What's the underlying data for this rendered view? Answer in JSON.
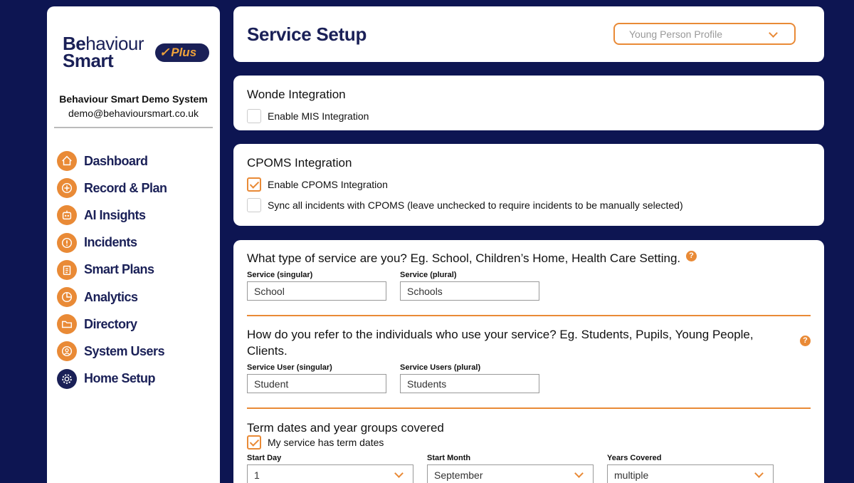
{
  "brand": {
    "logo_be": "Be",
    "logo_rest": "haviour",
    "logo_smart": "Smart",
    "plus_label": "Plus",
    "plus_check": "✓",
    "org_name": "Behaviour Smart Demo System",
    "org_email": "demo@behavioursmart.co.uk"
  },
  "nav": [
    {
      "label": "Dashboard",
      "icon": "home-icon"
    },
    {
      "label": "Record & Plan",
      "icon": "plus-circle-icon"
    },
    {
      "label": "AI Insights",
      "icon": "robot-icon"
    },
    {
      "label": "Incidents",
      "icon": "exclamation-icon"
    },
    {
      "label": "Smart Plans",
      "icon": "clipboard-icon"
    },
    {
      "label": "Analytics",
      "icon": "pie-chart-icon"
    },
    {
      "label": "Directory",
      "icon": "folder-icon"
    },
    {
      "label": "System Users",
      "icon": "user-icon"
    },
    {
      "label": "Home Setup",
      "icon": "gear-icon"
    }
  ],
  "header": {
    "title": "Service Setup",
    "profile_select": "Young Person Profile"
  },
  "wonde": {
    "title": "Wonde Integration",
    "enable_label": "Enable MIS Integration",
    "enable_checked": false
  },
  "cpoms": {
    "title": "CPOMS Integration",
    "enable_label": "Enable CPOMS Integration",
    "enable_checked": true,
    "sync_label": "Sync all incidents with CPOMS (leave unchecked to require incidents to be manually selected)",
    "sync_checked": false
  },
  "service": {
    "question": "What type of service are you? Eg. School, Children’s Home, Health Care Setting.",
    "help": "?",
    "singular_label": "Service (singular)",
    "singular_value": "School",
    "plural_label": "Service (plural)",
    "plural_value": "Schools"
  },
  "users": {
    "question": "How do you refer to the individuals who use your service? Eg. Students, Pupils, Young People, Clients.",
    "help": "?",
    "singular_label": "Service User (singular)",
    "singular_value": "Student",
    "plural_label": "Service Users (plural)",
    "plural_value": "Students"
  },
  "terms": {
    "title": "Term dates and year groups covered",
    "has_terms_label": "My service has term dates",
    "has_terms_checked": true,
    "start_day_label": "Start Day",
    "start_day_value": "1",
    "start_month_label": "Start Month",
    "start_month_value": "September",
    "years_label": "Years Covered",
    "years_value": "multiple"
  },
  "colors": {
    "background": "#0d1552",
    "brand_navy": "#1a2057",
    "accent_orange": "#e98a36"
  }
}
